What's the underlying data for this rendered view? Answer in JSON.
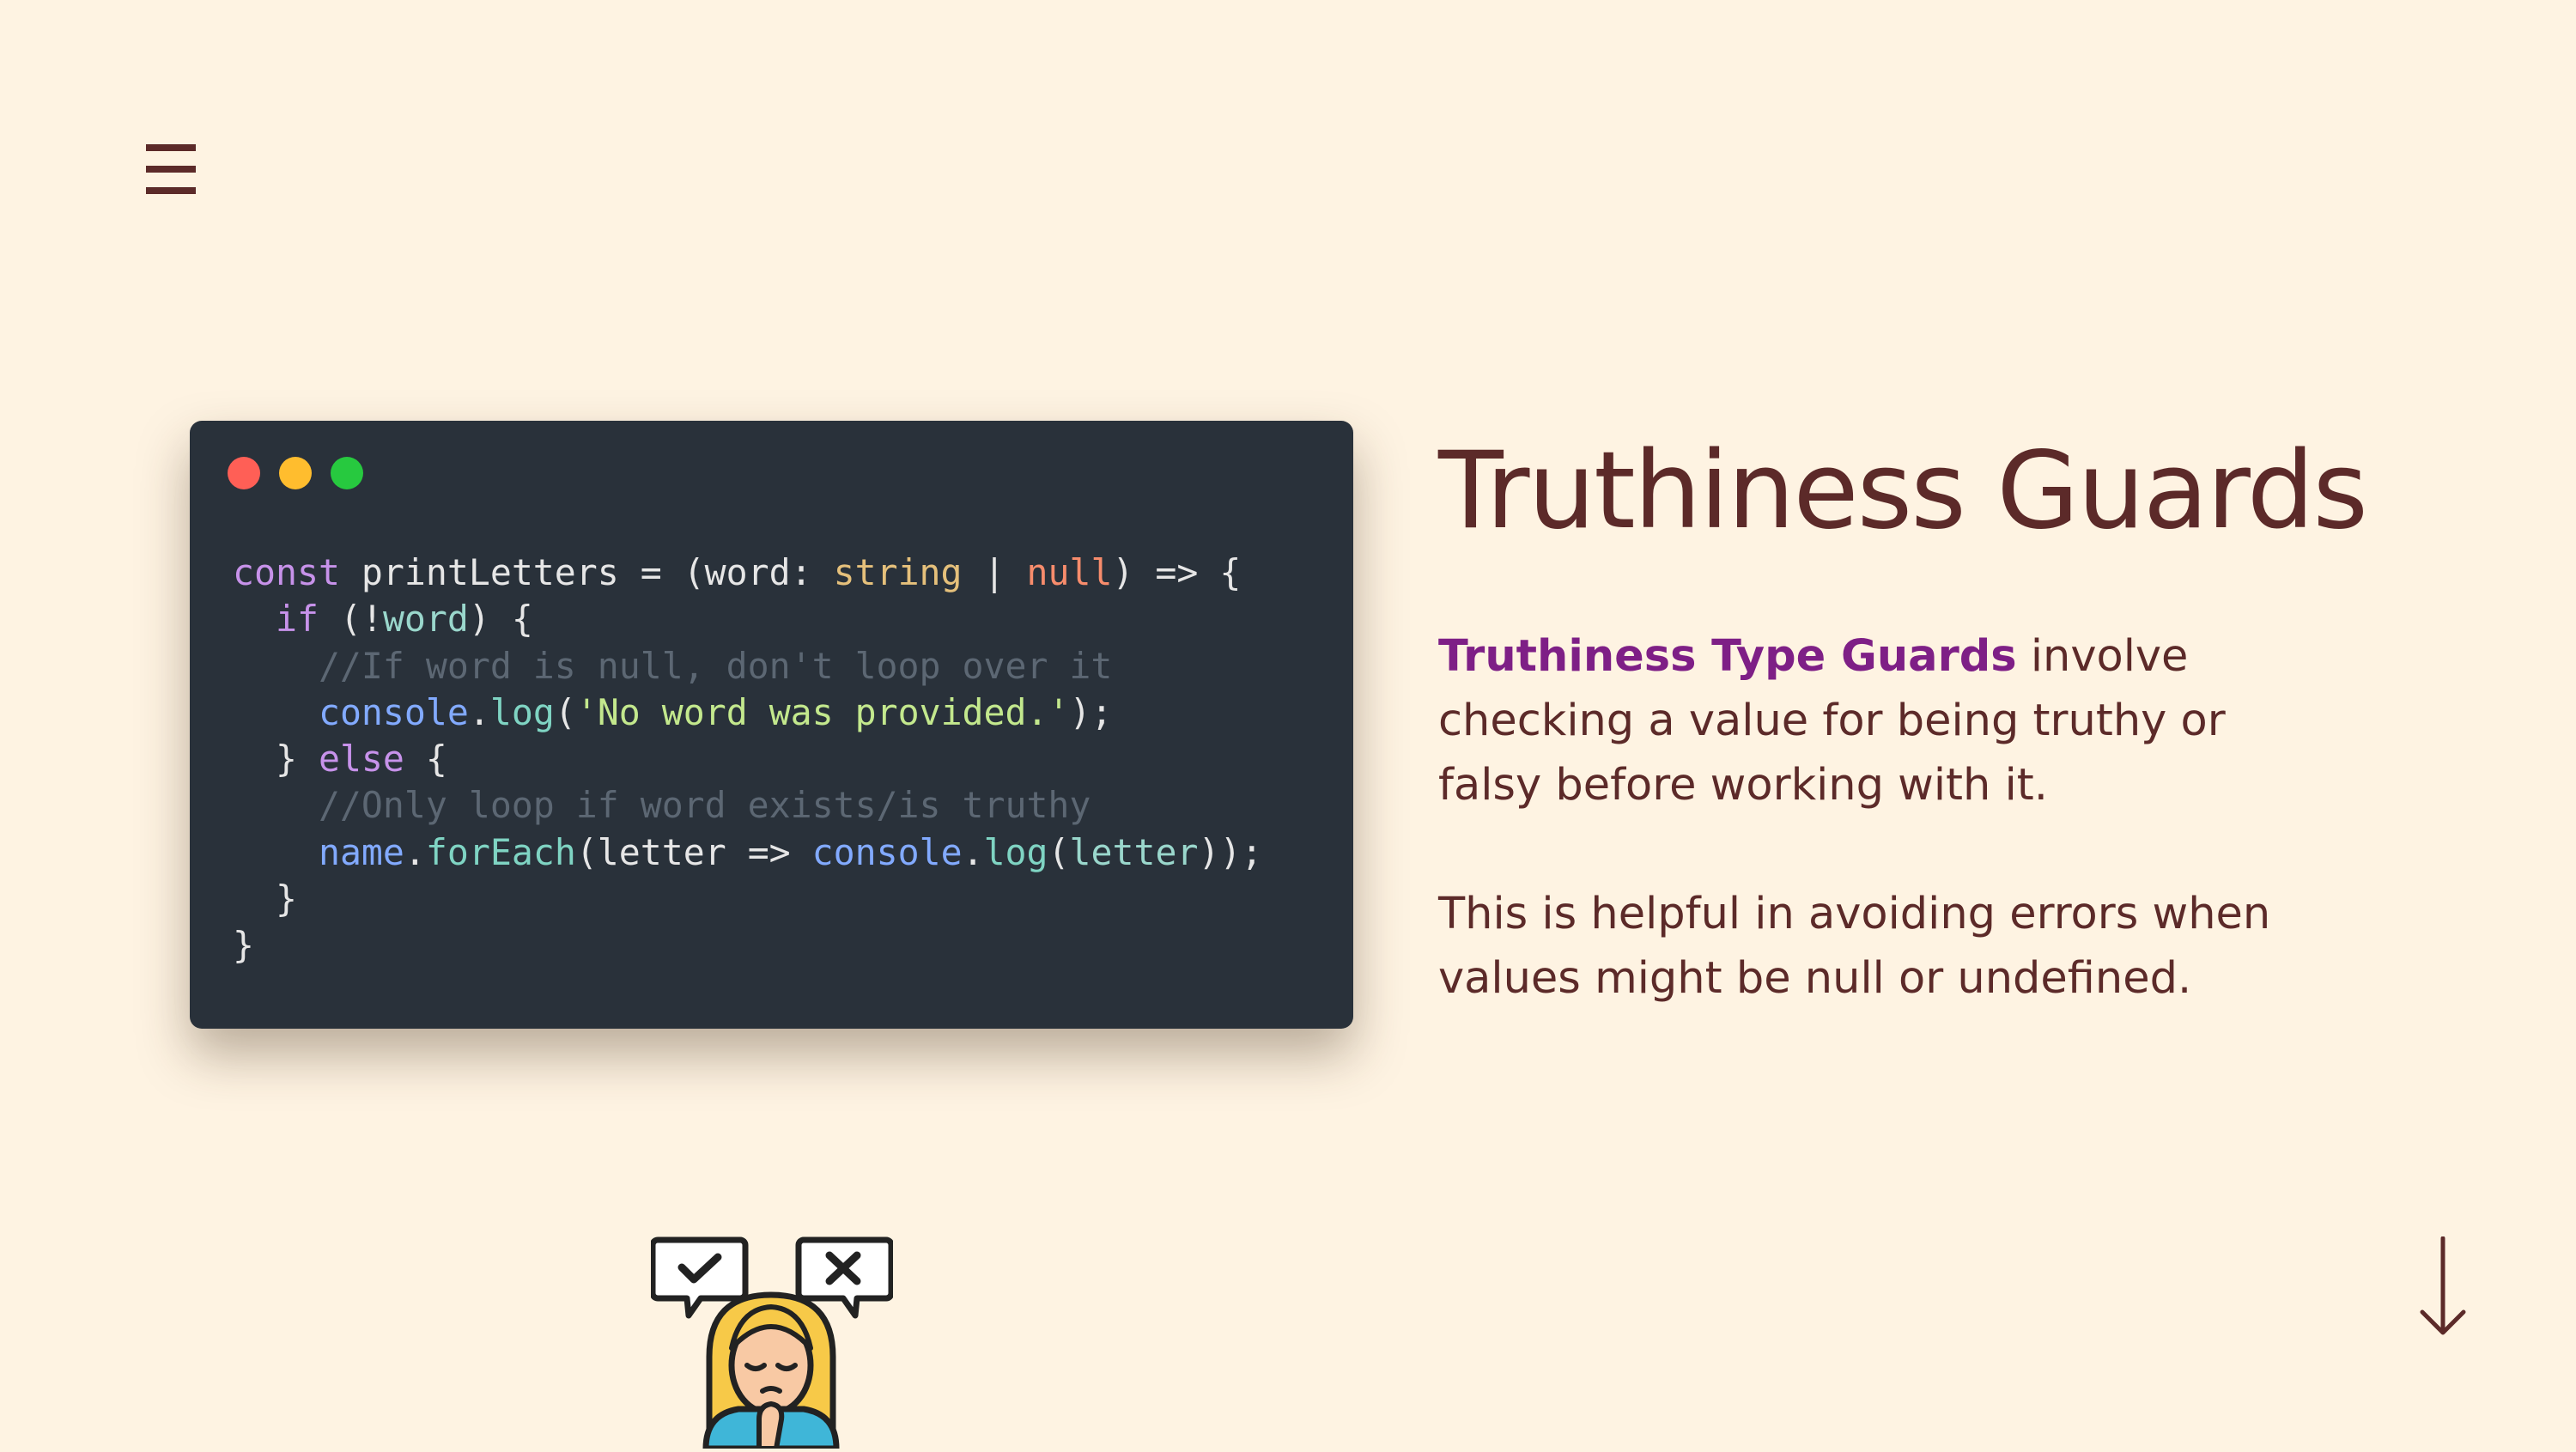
{
  "nav": {
    "menu_icon": "hamburger-menu-icon"
  },
  "code_window": {
    "dots": [
      "#ff5f56",
      "#ffbd2e",
      "#27c93f"
    ],
    "lines": [
      [
        {
          "t": "const",
          "c": "kw"
        },
        {
          "t": " printLetters = (word: ",
          "c": "plain"
        },
        {
          "t": "string",
          "c": "type"
        },
        {
          "t": " | ",
          "c": "plain"
        },
        {
          "t": "null",
          "c": "nul"
        },
        {
          "t": ") => {",
          "c": "plain"
        }
      ],
      [
        {
          "t": "  ",
          "c": "plain"
        },
        {
          "t": "if",
          "c": "kw"
        },
        {
          "t": " (!",
          "c": "plain"
        },
        {
          "t": "word",
          "c": "param"
        },
        {
          "t": ") {",
          "c": "plain"
        }
      ],
      [
        {
          "t": "    //If word is null, don't loop over it",
          "c": "cmt"
        }
      ],
      [
        {
          "t": "    ",
          "c": "plain"
        },
        {
          "t": "console",
          "c": "id"
        },
        {
          "t": ".",
          "c": "plain"
        },
        {
          "t": "log",
          "c": "method"
        },
        {
          "t": "(",
          "c": "plain"
        },
        {
          "t": "'No word was provided.'",
          "c": "str"
        },
        {
          "t": ");",
          "c": "plain"
        }
      ],
      [
        {
          "t": "  } ",
          "c": "plain"
        },
        {
          "t": "else",
          "c": "kw"
        },
        {
          "t": " {",
          "c": "plain"
        }
      ],
      [
        {
          "t": "    //Only loop if word exists/is truthy",
          "c": "cmt"
        }
      ],
      [
        {
          "t": "    ",
          "c": "plain"
        },
        {
          "t": "name",
          "c": "id"
        },
        {
          "t": ".",
          "c": "plain"
        },
        {
          "t": "forEach",
          "c": "method"
        },
        {
          "t": "(letter => ",
          "c": "plain"
        },
        {
          "t": "console",
          "c": "id"
        },
        {
          "t": ".",
          "c": "plain"
        },
        {
          "t": "log",
          "c": "method"
        },
        {
          "t": "(",
          "c": "plain"
        },
        {
          "t": "letter",
          "c": "param"
        },
        {
          "t": "));",
          "c": "plain"
        }
      ],
      [
        {
          "t": "  }",
          "c": "plain"
        }
      ],
      [
        {
          "t": "}",
          "c": "plain"
        }
      ]
    ]
  },
  "content": {
    "title": "Truthiness Guards",
    "para1_highlight": "Truthiness Type Guards",
    "para1_rest": " involve checking a value for being truthy or falsy before working with it.",
    "para2": "This is helpful in avoiding errors when values might be null or undefined."
  },
  "illustration": {
    "icon": "thinking-person-check-cross-icon"
  },
  "footer": {
    "scroll_icon": "down-arrow-icon"
  },
  "colors": {
    "background": "#fef3e2",
    "text": "#5c2a29",
    "accent": "#7e1f86",
    "code_bg": "#29313a"
  }
}
